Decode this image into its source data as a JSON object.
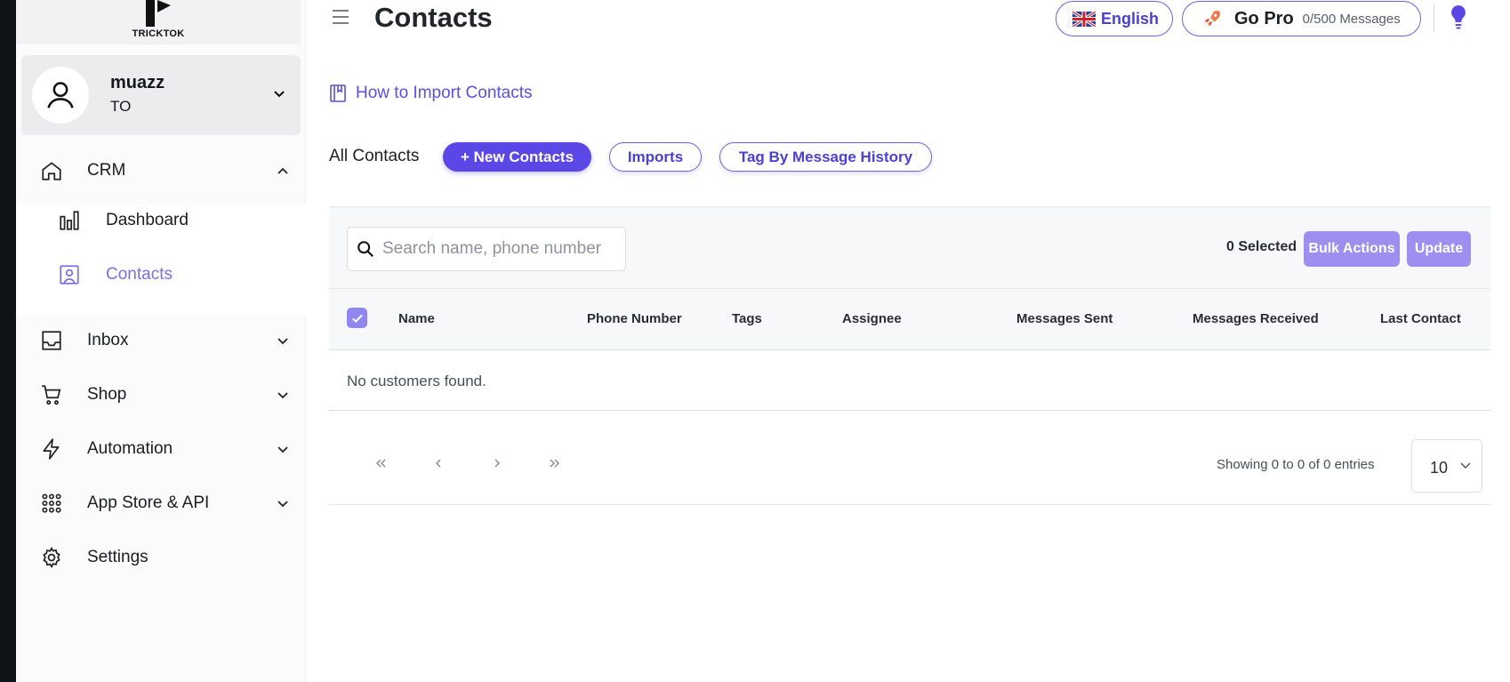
{
  "brand": {
    "name": "TRICKTOK"
  },
  "user": {
    "name": "muazz",
    "org": "TO"
  },
  "nav": {
    "crm": "CRM",
    "dashboard": "Dashboard",
    "contacts": "Contacts",
    "inbox": "Inbox",
    "shop": "Shop",
    "automation": "Automation",
    "app_store": "App Store & API",
    "settings": "Settings"
  },
  "header": {
    "title": "Contacts",
    "language": "English",
    "plan": "Go Pro",
    "message_quota": "0/500 Messages"
  },
  "import_link": "How to Import Contacts",
  "tabs": {
    "all": "All Contacts",
    "new": "+ New Contacts",
    "imports": "Imports",
    "tag": "Tag By Message History"
  },
  "toolbar": {
    "search_placeholder": "Search name, phone number",
    "selected": "0 Selected",
    "bulk": "Bulk Actions",
    "update": "Update"
  },
  "table": {
    "columns": [
      "Name",
      "Phone Number",
      "Tags",
      "Assignee",
      "Messages Sent",
      "Messages Received",
      "Last Contact"
    ],
    "empty": "No customers found."
  },
  "pagination": {
    "showing": "Showing 0 to 0 of 0 entries",
    "page_size": "10"
  },
  "colors": {
    "accent": "#5b47e6",
    "accent_light": "#9d8ff0",
    "active_nav": "#7b6fe6"
  }
}
